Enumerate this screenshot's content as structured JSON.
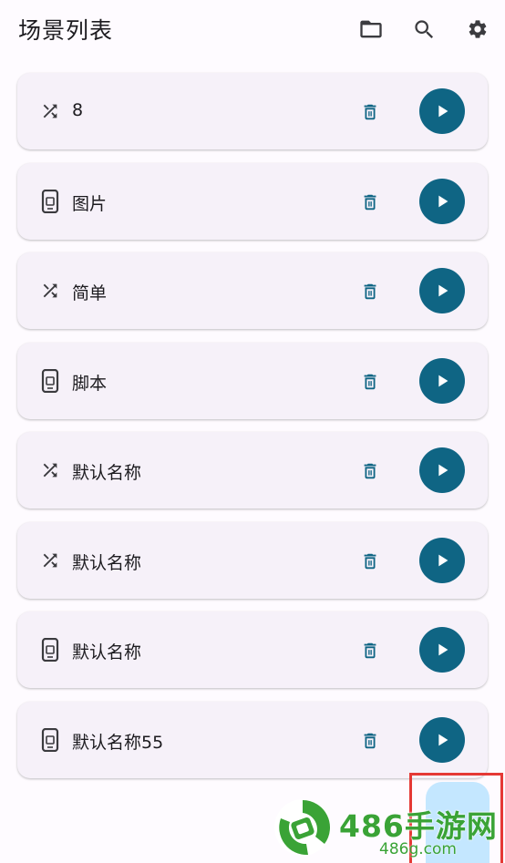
{
  "appbar": {
    "title": "场景列表",
    "actions": [
      {
        "name": "folder-open-icon"
      },
      {
        "name": "search-icon"
      },
      {
        "name": "settings-icon"
      }
    ]
  },
  "scenes": [
    {
      "type": "shuffle",
      "name": "8"
    },
    {
      "type": "phone",
      "name": "图片"
    },
    {
      "type": "shuffle",
      "name": "简单"
    },
    {
      "type": "phone",
      "name": "脚本"
    },
    {
      "type": "shuffle",
      "name": "默认名称"
    },
    {
      "type": "shuffle",
      "name": "默认名称"
    },
    {
      "type": "phone",
      "name": "默认名称"
    },
    {
      "type": "phone",
      "name": "默认名称55"
    }
  ],
  "watermark": {
    "brand": "486手游网",
    "domain": "486g.com"
  },
  "colors": {
    "accent": "#0f6584",
    "card": "#f6f1f9",
    "fab": "#c4e7ff",
    "highlight": "#e53935",
    "watermark_green": "#3aa336"
  }
}
